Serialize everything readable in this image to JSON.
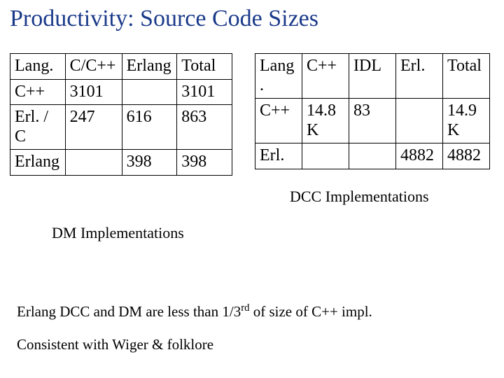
{
  "title": "Productivity: Source Code Sizes",
  "table_left": {
    "caption": "DM Implementations",
    "headers": [
      "Lang.",
      "C/C++",
      "Erlang",
      "Total"
    ],
    "rows": [
      {
        "lang": "C++",
        "cpp": "3101",
        "erlang": "",
        "total": "3101"
      },
      {
        "lang": "Erl. / C",
        "cpp": "247",
        "erlang": "616",
        "total": "863"
      },
      {
        "lang": "Erlang",
        "cpp": "",
        "erlang": "398",
        "total": "398"
      }
    ]
  },
  "table_right": {
    "caption": "DCC Implementations",
    "headers": [
      "Lang.",
      "C++",
      "IDL",
      "Erl.",
      "Total"
    ],
    "rows": [
      {
        "lang": "C++",
        "cpp": "14.8K",
        "idl": "83",
        "erl": "",
        "total": "14.9K"
      },
      {
        "lang": "Erl.",
        "cpp": "",
        "idl": "",
        "erl": "4882",
        "total": "4882"
      }
    ]
  },
  "note1_pre": "Erlang DCC and DM are less than 1/3",
  "note1_sup": "rd",
  "note1_post": " of size of C++ impl.",
  "note2": "Consistent with Wiger & folklore"
}
